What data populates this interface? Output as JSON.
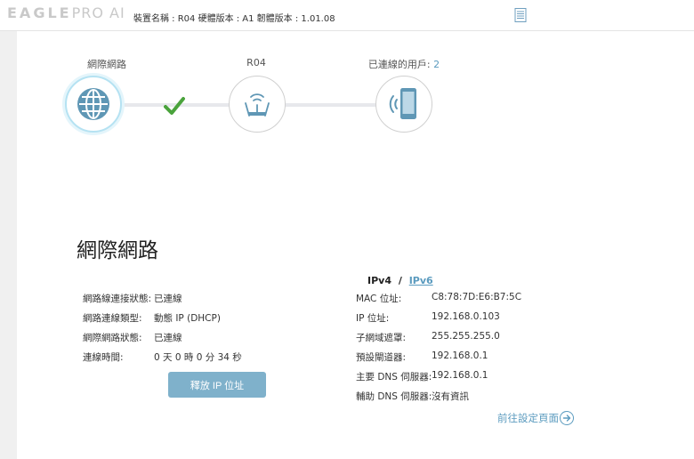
{
  "header": {
    "logo_main": "EAGLE",
    "logo_pro": "PRO AI",
    "device_info": "裝置名稱 : R04 硬體版本 : A1 韌體版本 : 1.01.08"
  },
  "topology": {
    "internet_label": "網際網路",
    "router_label": "R04",
    "clients_label": "已連線的用戶:",
    "clients_count": "2"
  },
  "section": {
    "title": "網際網路",
    "left": [
      {
        "label": "網路線連接狀態:",
        "value": "已連線"
      },
      {
        "label": "網路連線類型:",
        "value": "動態 IP (DHCP)"
      },
      {
        "label": "網際網路狀態:",
        "value": "已連線"
      },
      {
        "label": "連線時間:",
        "value": "0 天 0 時 0 分 34 秒"
      }
    ],
    "release_button": "釋放 IP 位址",
    "ip_toggle": {
      "v4": "IPv4",
      "sep": "/",
      "v6": "IPv6"
    },
    "right": [
      {
        "label": "MAC 位址:",
        "value": "C8:78:7D:E6:B7:5C"
      },
      {
        "label": "IP 位址:",
        "value": "192.168.0.103"
      },
      {
        "label": "子網域遮罩:",
        "value": "255.255.255.0"
      },
      {
        "label": "預設閘道器:",
        "value": "192.168.0.1"
      },
      {
        "label": "主要 DNS 伺服器:",
        "value": "192.168.0.1"
      },
      {
        "label": "輔助 DNS 伺服器:",
        "value": "沒有資訊"
      }
    ],
    "goto_settings": "前往設定頁面"
  },
  "colors": {
    "accent": "#5b9bbf",
    "button": "#7fb1cb",
    "check": "#4aa33c",
    "node_icon": "#5f97b5"
  }
}
